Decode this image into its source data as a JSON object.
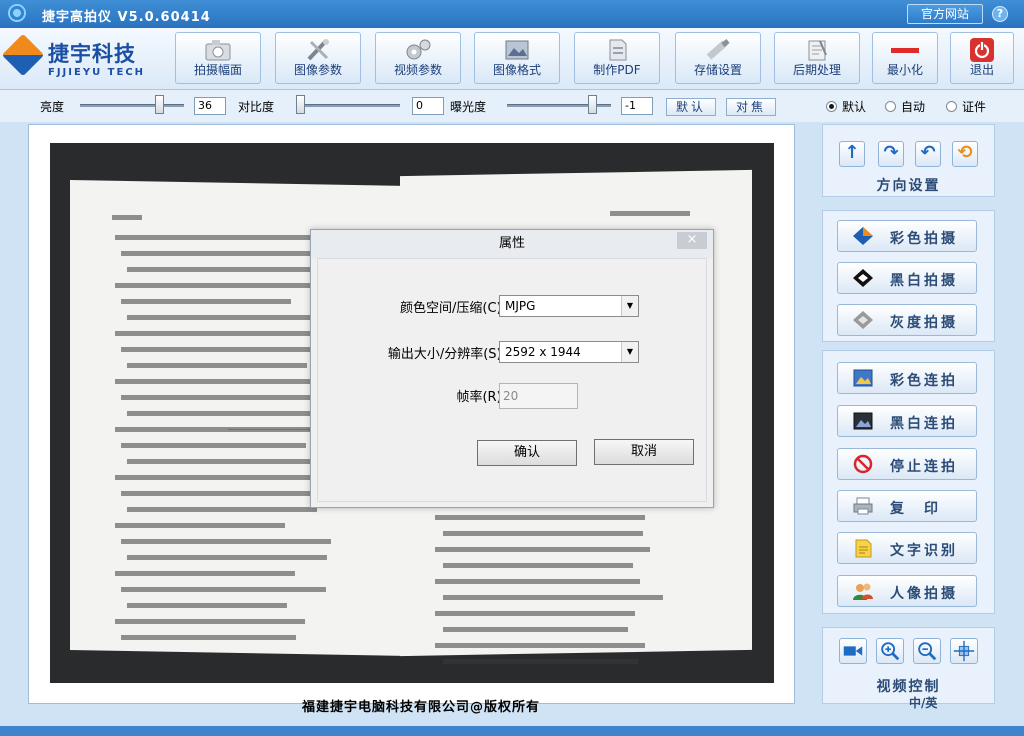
{
  "app": {
    "title": "捷宇高拍仪  V5.0.60414",
    "site_button": "官方网站",
    "help": "?"
  },
  "logo": {
    "name": "捷宇科技",
    "sub": "FJJIEYU TECH"
  },
  "toolbar": [
    {
      "id": "capture",
      "label": "拍摄幅面",
      "icon": "camera-icon"
    },
    {
      "id": "image-params",
      "label": "图像参数",
      "icon": "tools-icon"
    },
    {
      "id": "video-params",
      "label": "视频参数",
      "icon": "gears-icon"
    },
    {
      "id": "image-format",
      "label": "图像格式",
      "icon": "image-icon"
    },
    {
      "id": "make-pdf",
      "label": "制作PDF",
      "icon": "pdf-icon"
    },
    {
      "id": "storage",
      "label": "存储设置",
      "icon": "usb-icon"
    },
    {
      "id": "post",
      "label": "后期处理",
      "icon": "notes-icon"
    },
    {
      "id": "minimize",
      "label": "最小化",
      "icon": "minimize-icon"
    },
    {
      "id": "exit",
      "label": "退出",
      "icon": "power-icon"
    }
  ],
  "controls": {
    "brightness_label": "亮度",
    "brightness_value": "36",
    "contrast_label": "对比度",
    "contrast_value": "0",
    "exposure_label": "曝光度",
    "exposure_value": "-1",
    "default_button": "默认",
    "focus_button": "对焦",
    "modes": [
      {
        "label": "默认",
        "checked": true
      },
      {
        "label": "自动",
        "checked": false
      },
      {
        "label": "证件",
        "checked": false
      }
    ]
  },
  "direction": {
    "title": "方向设置",
    "buttons": [
      "arrow-up-icon",
      "rotate-right-icon",
      "rotate-left-icon",
      "refresh-icon"
    ]
  },
  "capture_buttons": [
    {
      "label": "彩色拍摄",
      "icon": "color-capture-icon"
    },
    {
      "label": "黑白拍摄",
      "icon": "bw-capture-icon"
    },
    {
      "label": "灰度拍摄",
      "icon": "gray-capture-icon"
    }
  ],
  "continuous_buttons": [
    {
      "label": "彩色连拍",
      "icon": "color-photo-icon"
    },
    {
      "label": "黑白连拍",
      "icon": "bw-photo-icon"
    },
    {
      "label": "停止连拍",
      "icon": "stop-icon"
    },
    {
      "label": "复　印",
      "icon": "printer-icon"
    },
    {
      "label": "文字识别",
      "icon": "document-icon"
    },
    {
      "label": "人像拍摄",
      "icon": "people-icon"
    }
  ],
  "video_control": {
    "title": "视频控制",
    "buttons": [
      "video-camera-icon",
      "zoom-in-icon",
      "zoom-out-icon",
      "fit-screen-icon"
    ],
    "language_label": "中/英"
  },
  "footer": {
    "copyright": "福建捷宇电脑科技有限公司@版权所有"
  },
  "dialog": {
    "title": "属性",
    "close": "×",
    "color_space_label": "颜色空间/压缩(C):",
    "color_space_value": "MJPG",
    "resolution_label": "输出大小/分辨率(S):",
    "resolution_value": "2592 x 1944",
    "framerate_label": "帧率(R):",
    "framerate_value": "20",
    "ok": "确认",
    "cancel": "取消"
  },
  "colors": {
    "accent": "#2a72bf",
    "panel": "#e9f2fc",
    "title_text": "#2c4c77"
  }
}
